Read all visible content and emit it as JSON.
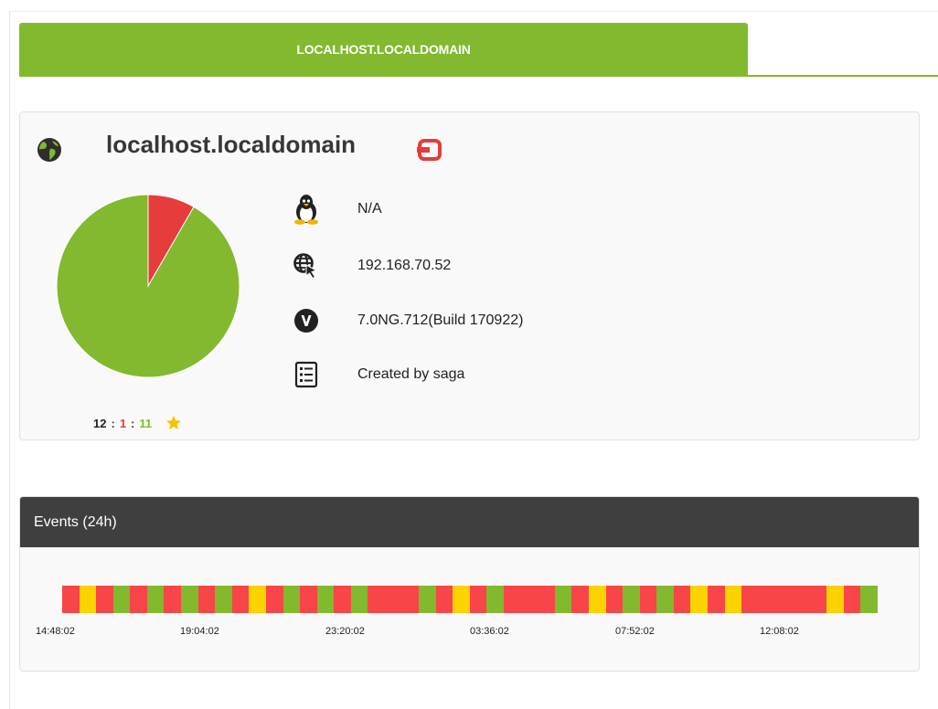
{
  "tab": {
    "label": "LOCALHOST.LOCALDOMAIN"
  },
  "agent": {
    "name": "localhost.localdomain",
    "icons": {
      "group": "globe-icon",
      "remote": "remote-config-icon"
    },
    "modules_pie": {
      "normal": 11,
      "critical": 1
    },
    "counts": {
      "total": "12",
      "critical": "1",
      "normal": "11",
      "separator": ":"
    },
    "info": [
      {
        "icon": "linux-penguin-icon",
        "text": "N/A"
      },
      {
        "icon": "ip-address-icon",
        "text": "192.168.70.52"
      },
      {
        "icon": "version-icon",
        "text": "7.0NG.712(Build 170922)"
      },
      {
        "icon": "description-icon",
        "text": "Created by saga"
      }
    ]
  },
  "events": {
    "title": "Events (24h)",
    "colors": {
      "red": "#f84548",
      "yellow": "#fcd300",
      "green": "#82b92e"
    },
    "segments": [
      "red",
      "yellow",
      "red",
      "green",
      "red",
      "green",
      "red",
      "green",
      "red",
      "green",
      "red",
      "yellow",
      "red",
      "green",
      "red",
      "green",
      "red",
      "green",
      "red",
      "red",
      "red",
      "green",
      "red",
      "yellow",
      "red",
      "green",
      "red",
      "red",
      "red",
      "green",
      "red",
      "yellow",
      "red",
      "green",
      "red",
      "green",
      "red",
      "yellow",
      "red",
      "yellow",
      "red",
      "red",
      "red",
      "red",
      "red",
      "yellow",
      "red",
      "green"
    ],
    "ticks": [
      "14:48:02",
      "19:04:02",
      "23:20:02",
      "03:36:02",
      "07:52:02",
      "12:08:02"
    ]
  },
  "colors": {
    "accent": "#82b92e",
    "critical": "#e63c3c",
    "warning": "#fcd300",
    "header": "#3f3f3f"
  }
}
